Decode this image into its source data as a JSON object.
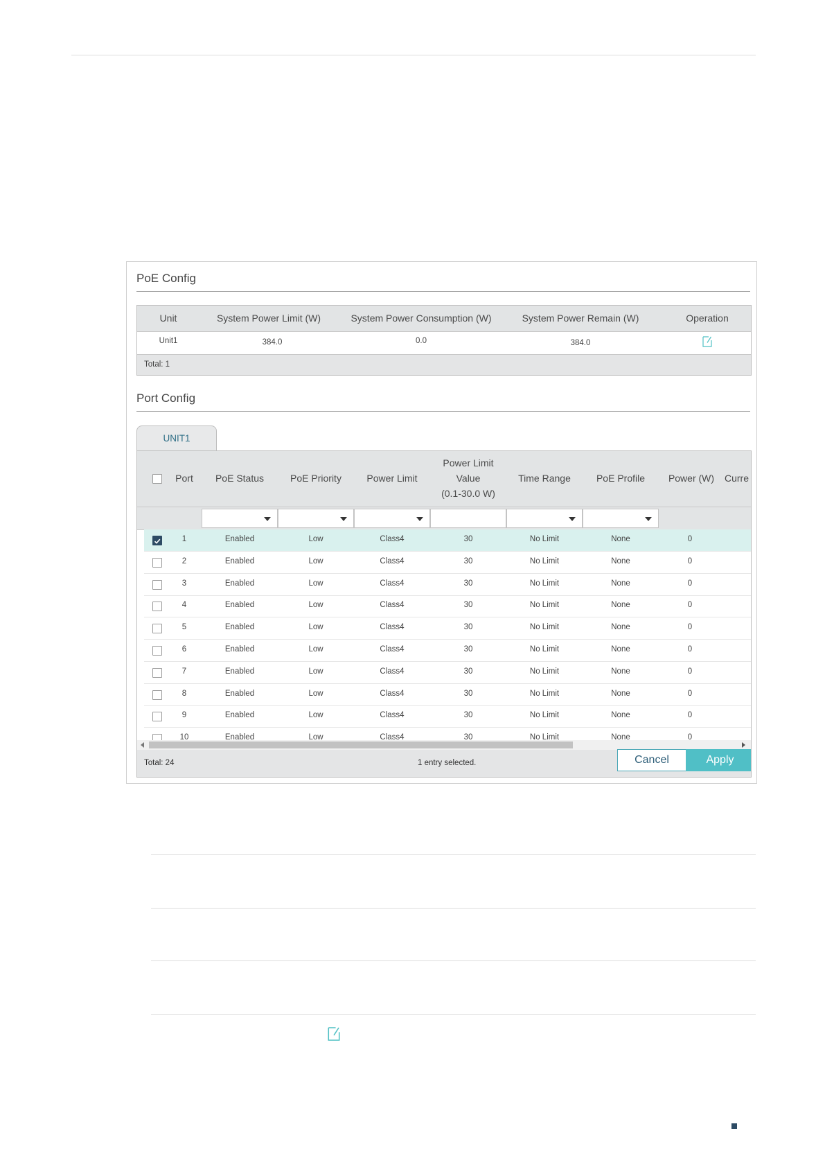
{
  "poe_config": {
    "title": "PoE Config",
    "columns": [
      "Unit",
      "System Power Limit (W)",
      "System Power Consumption (W)",
      "System Power Remain (W)",
      "Operation"
    ],
    "row": {
      "unit": "Unit1",
      "limit": "384.0",
      "consumption": "0.0",
      "remain": "384.0"
    },
    "total": "Total: 1"
  },
  "port_config": {
    "title": "Port Config",
    "tab": "UNIT1",
    "columns": {
      "port": "Port",
      "status": "PoE Status",
      "priority": "PoE Priority",
      "power_limit": "Power Limit",
      "plv_1": "Power Limit",
      "plv_2": "Value",
      "plv_3": "(0.1-30.0 W)",
      "time_range": "Time Range",
      "profile": "PoE Profile",
      "power": "Power (W)",
      "current": "Curre"
    },
    "rows": [
      {
        "port": "1",
        "status": "Enabled",
        "priority": "Low",
        "limit": "Class4",
        "value": "30",
        "time": "No Limit",
        "profile": "None",
        "power": "0",
        "checked": true
      },
      {
        "port": "2",
        "status": "Enabled",
        "priority": "Low",
        "limit": "Class4",
        "value": "30",
        "time": "No Limit",
        "profile": "None",
        "power": "0",
        "checked": false
      },
      {
        "port": "3",
        "status": "Enabled",
        "priority": "Low",
        "limit": "Class4",
        "value": "30",
        "time": "No Limit",
        "profile": "None",
        "power": "0",
        "checked": false
      },
      {
        "port": "4",
        "status": "Enabled",
        "priority": "Low",
        "limit": "Class4",
        "value": "30",
        "time": "No Limit",
        "profile": "None",
        "power": "0",
        "checked": false
      },
      {
        "port": "5",
        "status": "Enabled",
        "priority": "Low",
        "limit": "Class4",
        "value": "30",
        "time": "No Limit",
        "profile": "None",
        "power": "0",
        "checked": false
      },
      {
        "port": "6",
        "status": "Enabled",
        "priority": "Low",
        "limit": "Class4",
        "value": "30",
        "time": "No Limit",
        "profile": "None",
        "power": "0",
        "checked": false
      },
      {
        "port": "7",
        "status": "Enabled",
        "priority": "Low",
        "limit": "Class4",
        "value": "30",
        "time": "No Limit",
        "profile": "None",
        "power": "0",
        "checked": false
      },
      {
        "port": "8",
        "status": "Enabled",
        "priority": "Low",
        "limit": "Class4",
        "value": "30",
        "time": "No Limit",
        "profile": "None",
        "power": "0",
        "checked": false
      },
      {
        "port": "9",
        "status": "Enabled",
        "priority": "Low",
        "limit": "Class4",
        "value": "30",
        "time": "No Limit",
        "profile": "None",
        "power": "0",
        "checked": false
      },
      {
        "port": "10",
        "status": "Enabled",
        "priority": "Low",
        "limit": "Class4",
        "value": "30",
        "time": "No Limit",
        "profile": "None",
        "power": "0",
        "checked": false
      }
    ],
    "total": "Total: 24",
    "selected": "1 entry selected.",
    "cancel": "Cancel",
    "apply": "Apply"
  },
  "colors": {
    "accent": "#50bfc6",
    "selected_row": "#d9f1ee",
    "header_bg": "#e2e4e5",
    "checkbox_on": "#2d4b64"
  },
  "icons": {
    "edit": "edit-icon",
    "page_marker": "square-icon"
  }
}
